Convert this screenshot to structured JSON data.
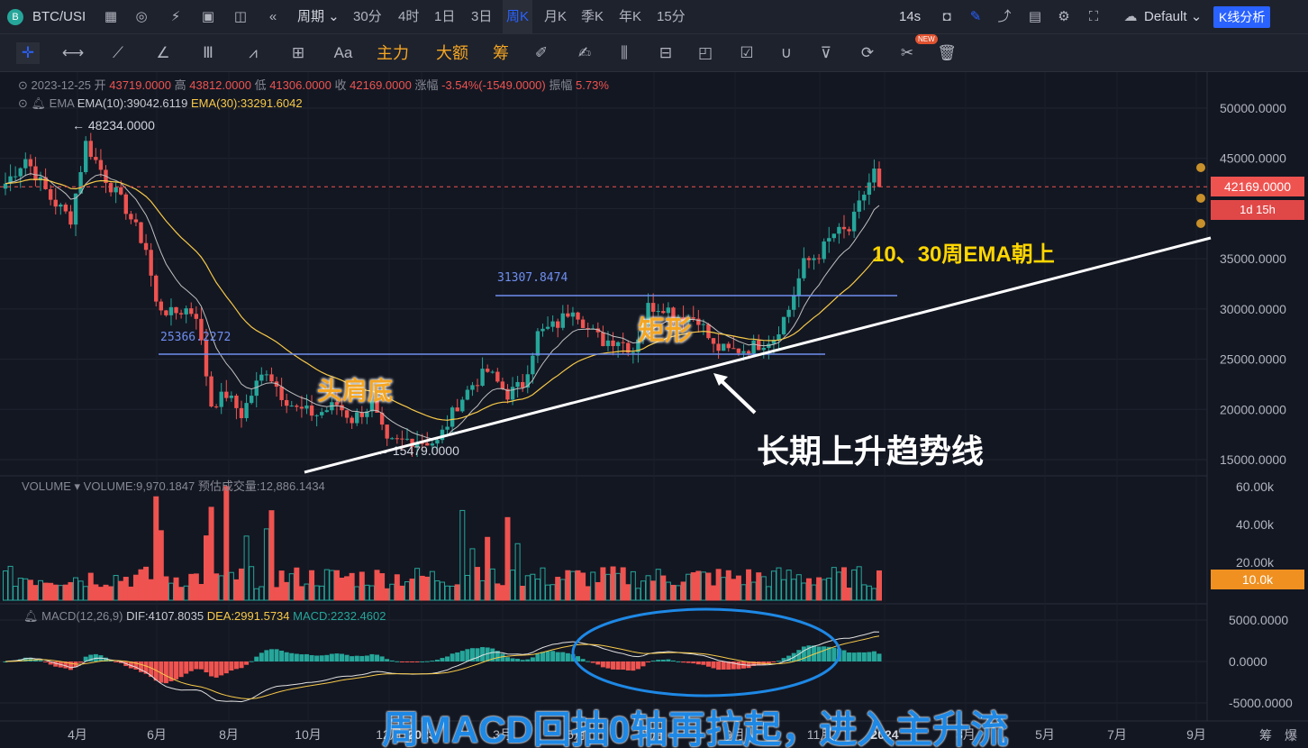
{
  "topbar": {
    "symbol": "BTC/USI",
    "period_label": "周期",
    "intervals": [
      "30分",
      "4时",
      "1日",
      "3日",
      "周K",
      "月K",
      "季K",
      "年K",
      "15分"
    ],
    "active_interval": "周K",
    "refresh": "14s",
    "theme": "Default",
    "analysis_button": "K线分析"
  },
  "toolbar": {
    "text_tool": "Aa",
    "main_force": "主力",
    "big_amount": "大额",
    "chips": "筹",
    "new_badge": "NEW"
  },
  "legend": {
    "date": "2023-12-25",
    "open_label": "开",
    "open": "43719.0000",
    "high_label": "高",
    "high": "43812.0000",
    "low_label": "低",
    "low": "41306.0000",
    "close_label": "收",
    "close": "42169.0000",
    "change_label": "涨幅",
    "change": "-3.54%(-1549.0000)",
    "amp_label": "振幅",
    "amp": "5.73%",
    "ema_name": "EMA",
    "ema10": "EMA(10):39042.6119",
    "ema30": "EMA(30):33291.6042"
  },
  "volume_legend": {
    "name": "VOLUME",
    "value": "VOLUME:9,970.1847",
    "estimate": "预估成交量:12,886.1434"
  },
  "macd_legend": {
    "name": "MACD(12,26,9)",
    "dif": "DIF:4107.8035",
    "dea": "DEA:2991.5734",
    "macd": "MACD:2232.4602"
  },
  "price_axis": [
    "50000.0000",
    "45000.0000",
    "40000.0000",
    "35000.0000",
    "30000.0000",
    "25000.0000",
    "20000.0000",
    "15000.0000"
  ],
  "volume_axis": [
    "60.00k",
    "40.00k",
    "20.00k"
  ],
  "macd_axis": [
    "5000.0000",
    "0.0000",
    "-5000.0000"
  ],
  "time_axis": [
    "4月",
    "6月",
    "8月",
    "10月",
    "12月",
    "2023",
    "3月",
    "5月",
    "7月",
    "9月",
    "11月",
    "2024",
    "3月",
    "5月",
    "7月",
    "9月"
  ],
  "bottom_right": [
    "筹",
    "爆"
  ],
  "current_price": "42169.0000",
  "countdown": "1d 15h",
  "current_volume": "10.0k",
  "marks": {
    "high_2022": "← 48234.0000",
    "low_2022": "← 15479.0000",
    "neckline": "25366.2272",
    "range_top": "31307.8474"
  },
  "annotations": {
    "inverse_hs": "头肩底",
    "rectangle": "矩形",
    "ema_up": "10、30周EMA朝上",
    "trendline": "长期上升趋势线",
    "macd_note": "周MACD回抽0轴再拉起，进入主升流"
  },
  "colors": {
    "background": "#131722",
    "up": "#26a69a",
    "down": "#ef5350",
    "ema10": "#c0c0c0",
    "ema30": "#f7c948",
    "accent": "#2962ff",
    "annotation_orange": "#f5a623",
    "annotation_blue": "#1e88e5"
  }
}
